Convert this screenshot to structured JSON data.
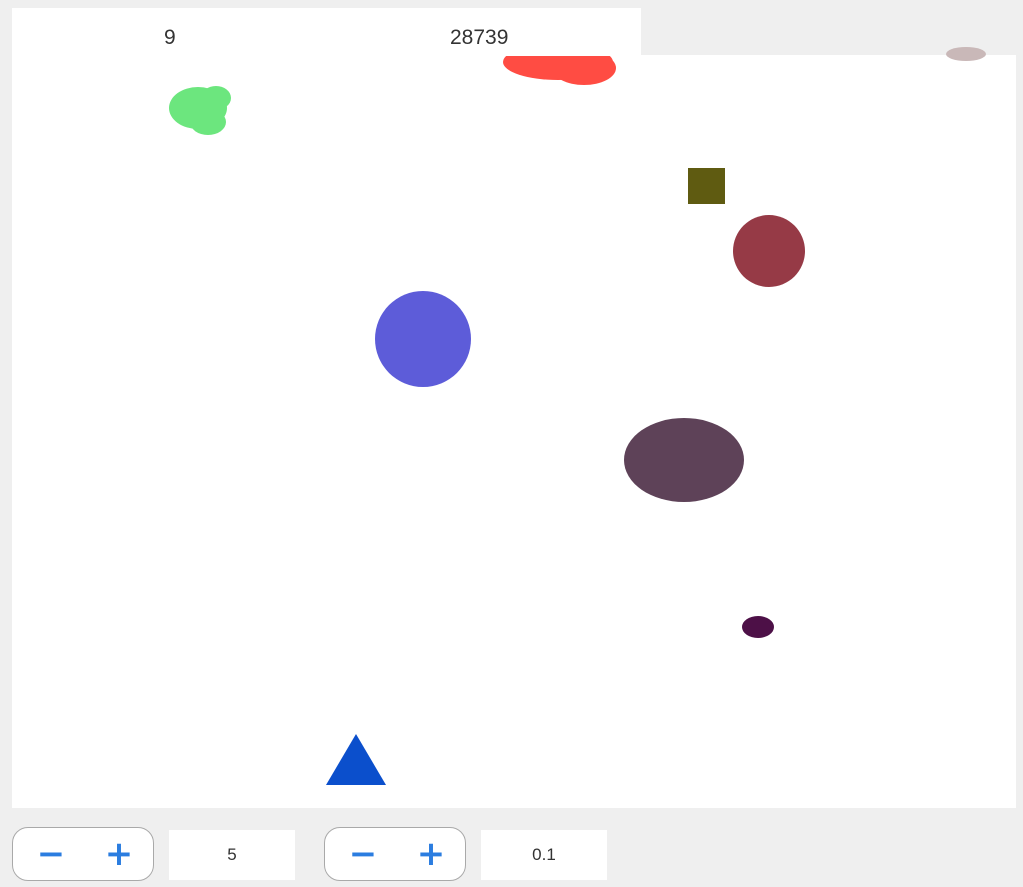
{
  "hud": {
    "lives": "9",
    "score": "28739"
  },
  "controls": {
    "stepper_1": {
      "minus_icon": "minus-icon",
      "plus_icon": "plus-icon",
      "minus_glyph": "−",
      "plus_glyph": "+",
      "value": "5"
    },
    "stepper_2": {
      "minus_icon": "minus-icon",
      "plus_icon": "plus-icon",
      "minus_glyph": "−",
      "plus_glyph": "+",
      "value": "0.1"
    },
    "accent_color": "#2b7de0"
  },
  "game": {
    "player": {
      "shape": "triangle",
      "color": "#0b4fcc"
    },
    "objects": [
      {
        "name": "red-blob",
        "shape": "blob",
        "color": "#ff4c43"
      },
      {
        "name": "grey-blob",
        "shape": "blob",
        "color": "#c9b8b8"
      },
      {
        "name": "green-blob",
        "shape": "blob",
        "color": "#6ce67e"
      },
      {
        "name": "olive-square",
        "shape": "square",
        "color": "#5f5b11"
      },
      {
        "name": "maroon-circle",
        "shape": "circle",
        "color": "#963a46"
      },
      {
        "name": "blue-circle",
        "shape": "circle",
        "color": "#5d5cd9"
      },
      {
        "name": "plum-ellipse",
        "shape": "ellipse",
        "color": "#5e4258"
      },
      {
        "name": "purple-ellipse",
        "shape": "ellipse",
        "color": "#4d1047"
      }
    ]
  }
}
